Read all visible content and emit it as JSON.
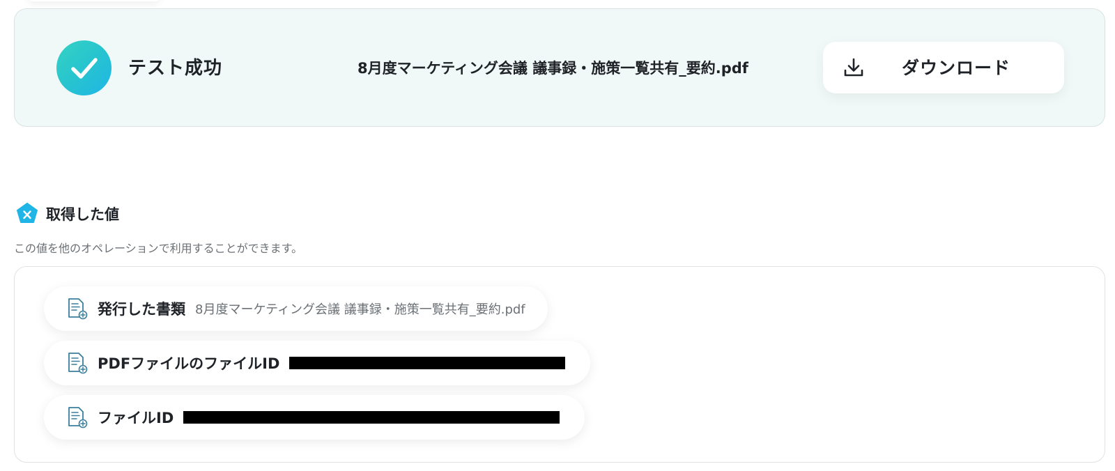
{
  "result": {
    "status_label": "テスト成功",
    "file_name": "8月度マーケティング会議 議事録・施策一覧共有_要約.pdf",
    "download_label": "ダウンロード"
  },
  "values": {
    "title": "取得した値",
    "description": "この値を他のオペレーションで利用することができます。",
    "items": [
      {
        "key": "発行した書類",
        "value": "8月度マーケティング会議 議事録・施策一覧共有_要約.pdf"
      },
      {
        "key": "PDFファイルのファイルID",
        "value": ""
      },
      {
        "key": "ファイルID",
        "value": ""
      }
    ]
  },
  "colors": {
    "accent": "#1fb5e6",
    "success_gradient_start": "#36d2c4",
    "card_background": "#f1f9f8",
    "redaction": "#000000"
  },
  "icons": {
    "success": "check-icon",
    "download": "download-icon",
    "values": "variable-icon",
    "item": "document-icon"
  }
}
